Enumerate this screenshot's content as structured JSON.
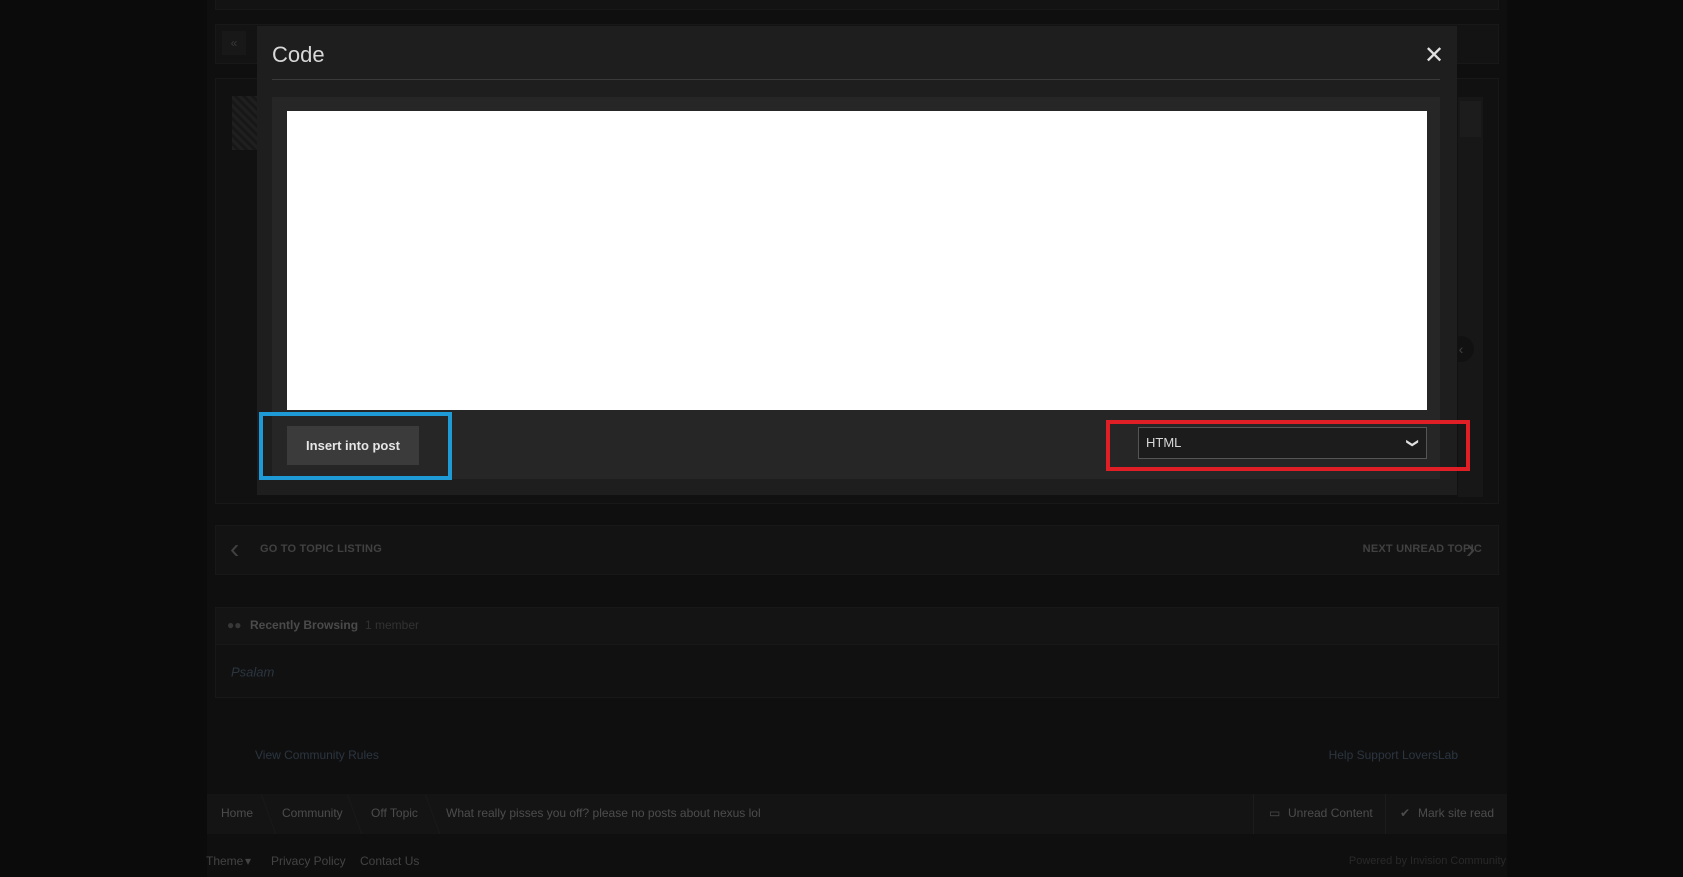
{
  "modal": {
    "title": "Code",
    "close_icon": "close-icon",
    "code_value": "",
    "insert_button": "Insert into post",
    "language_select": {
      "selected": "HTML",
      "icon": "chevron-down-icon"
    }
  },
  "highlights": {
    "insert_color": "#1e9ad6",
    "select_color": "#e01e26"
  },
  "topic_nav": {
    "prev_label": "GO TO TOPIC LISTING",
    "next_label": "NEXT UNREAD TOPIC"
  },
  "recently_browsing": {
    "title": "Recently Browsing",
    "count": "1 member",
    "members": [
      "Psalam"
    ]
  },
  "footer": {
    "rules_link": "View Community Rules",
    "support_link": "Help Support LoversLab"
  },
  "breadcrumb": {
    "items": [
      "Home",
      "Community",
      "Off Topic",
      "What really pisses you off? please no posts about nexus lol"
    ],
    "unread": "Unread Content",
    "mark_read": "Mark site read"
  },
  "bottom": {
    "theme": "Theme",
    "privacy": "Privacy Policy",
    "contact": "Contact Us",
    "powered": "Powered by Invision Community"
  }
}
